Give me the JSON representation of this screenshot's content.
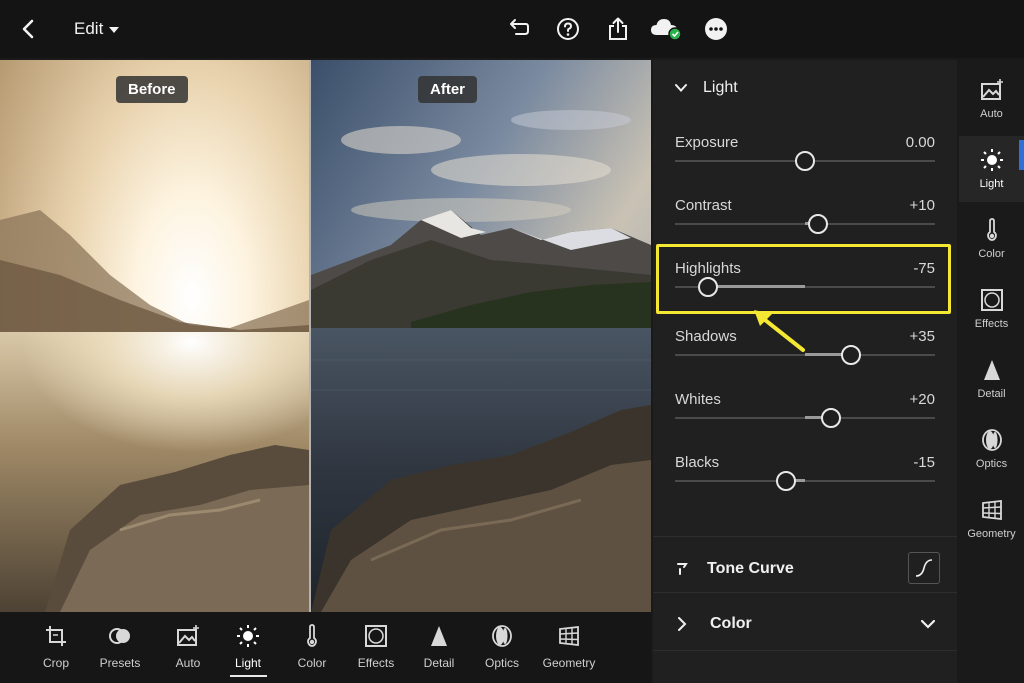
{
  "topbar": {
    "edit_label": "Edit",
    "icons": [
      "back-arrow-icon",
      "undo-icon",
      "help-icon",
      "share-icon",
      "cloud-synced-icon",
      "more-icon"
    ]
  },
  "photo": {
    "before_label": "Before",
    "after_label": "After"
  },
  "bottom_toolbar": {
    "items": [
      {
        "label": "Crop",
        "icon": "crop-icon"
      },
      {
        "label": "Presets",
        "icon": "presets-icon"
      },
      {
        "label": "Auto",
        "icon": "auto-icon"
      },
      {
        "label": "Light",
        "icon": "sun-icon",
        "active": true
      },
      {
        "label": "Color",
        "icon": "thermometer-icon"
      },
      {
        "label": "Effects",
        "icon": "effects-icon"
      },
      {
        "label": "Detail",
        "icon": "triangle-icon"
      },
      {
        "label": "Optics",
        "icon": "optics-icon"
      },
      {
        "label": "Geometry",
        "icon": "geometry-icon"
      }
    ]
  },
  "panel": {
    "light_title": "Light",
    "sliders": [
      {
        "label": "Exposure",
        "value": "0.00",
        "level": 0.0
      },
      {
        "label": "Contrast",
        "value": "+10",
        "level": 10
      },
      {
        "label": "Highlights",
        "value": "-75",
        "level": -75
      },
      {
        "label": "Shadows",
        "value": "+35",
        "level": 35
      },
      {
        "label": "Whites",
        "value": "+20",
        "level": 20
      },
      {
        "label": "Blacks",
        "value": "-15",
        "level": -15
      }
    ],
    "tone_curve_label": "Tone Curve",
    "color_label": "Color"
  },
  "rail": {
    "items": [
      {
        "label": "Auto",
        "icon": "auto-icon"
      },
      {
        "label": "Light",
        "icon": "sun-icon",
        "active": true
      },
      {
        "label": "Color",
        "icon": "thermometer-icon"
      },
      {
        "label": "Effects",
        "icon": "effects-icon"
      },
      {
        "label": "Detail",
        "icon": "triangle-icon"
      },
      {
        "label": "Optics",
        "icon": "optics-icon"
      },
      {
        "label": "Geometry",
        "icon": "geometry-icon"
      }
    ]
  },
  "colors": {
    "highlight_box": "#f5e832",
    "panel_bg": "#202020"
  }
}
